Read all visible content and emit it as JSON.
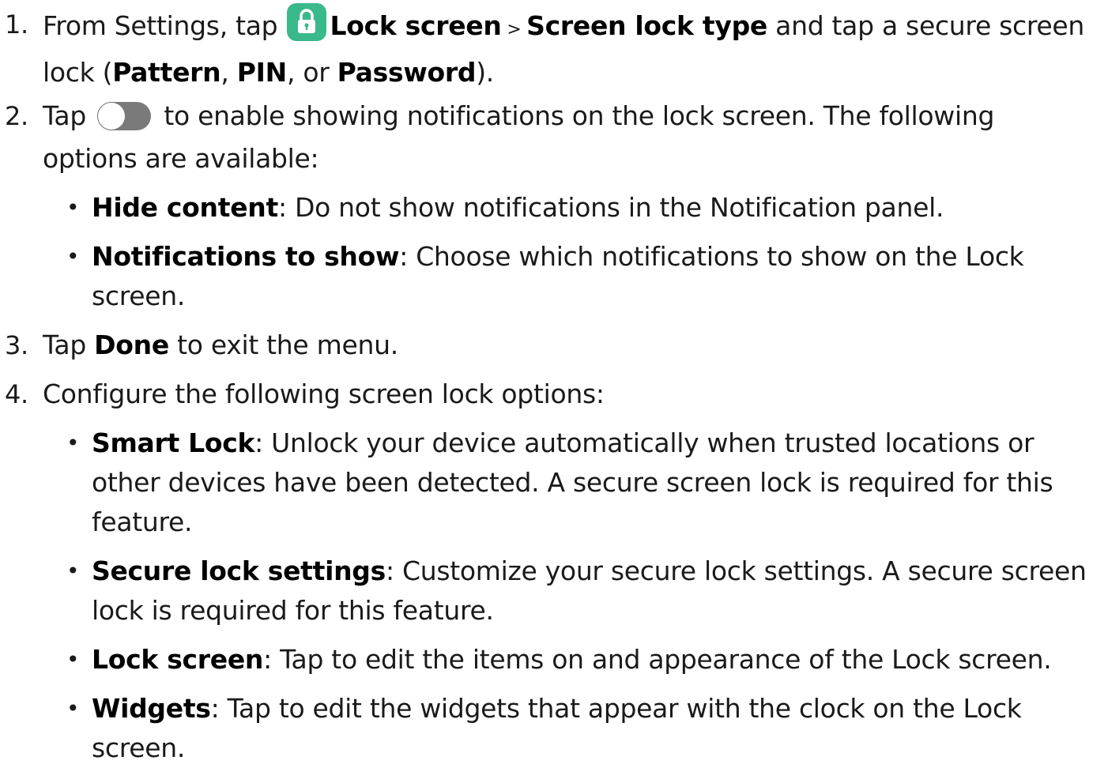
{
  "steps": [
    {
      "num": "1.",
      "p1": "From Settings, tap ",
      "b1": "Lock screen",
      "sep": " > ",
      "b2": "Screen lock type",
      "p2": " and tap a secure screen lock (",
      "b3": "Pattern",
      "p3": ", ",
      "b4": "PIN",
      "p4": ", or ",
      "b5": "Password",
      "p5": ")."
    },
    {
      "num": "2.",
      "p1": "Tap ",
      "p2": " to enable showing notifications on the lock screen. The following options are available:"
    },
    {
      "num": "3.",
      "p1": "Tap ",
      "b1": "Done",
      "p2": " to exit the menu."
    },
    {
      "num": "4.",
      "p1": "Configure the following screen lock options:"
    }
  ],
  "step2_bullets": [
    {
      "term": "Hide content",
      "desc": ": Do not show notifications in the Notification panel."
    },
    {
      "term": "Notifications to show",
      "desc": ": Choose which notifications to show on the Lock screen."
    }
  ],
  "step4_bullets": [
    {
      "term": "Smart Lock",
      "desc": ": Unlock your device automatically when trusted locations or other devices have been detected. A secure screen lock is required for this feature."
    },
    {
      "term": "Secure lock settings",
      "desc": ": Customize your secure lock settings. A secure screen lock is required for this feature."
    },
    {
      "term": "Lock screen",
      "desc": ": Tap to edit the items on and appearance of the Lock screen."
    },
    {
      "term": "Widgets",
      "desc": ": Tap to edit the widgets that appear with the clock on the Lock screen."
    }
  ],
  "bullet_glyph": "•",
  "icons": {
    "lock": "lock-icon",
    "toggle": "toggle-off-icon"
  },
  "colors": {
    "lock_icon_bg": "#3ab98a",
    "toggle_track": "#7a7a7a"
  }
}
